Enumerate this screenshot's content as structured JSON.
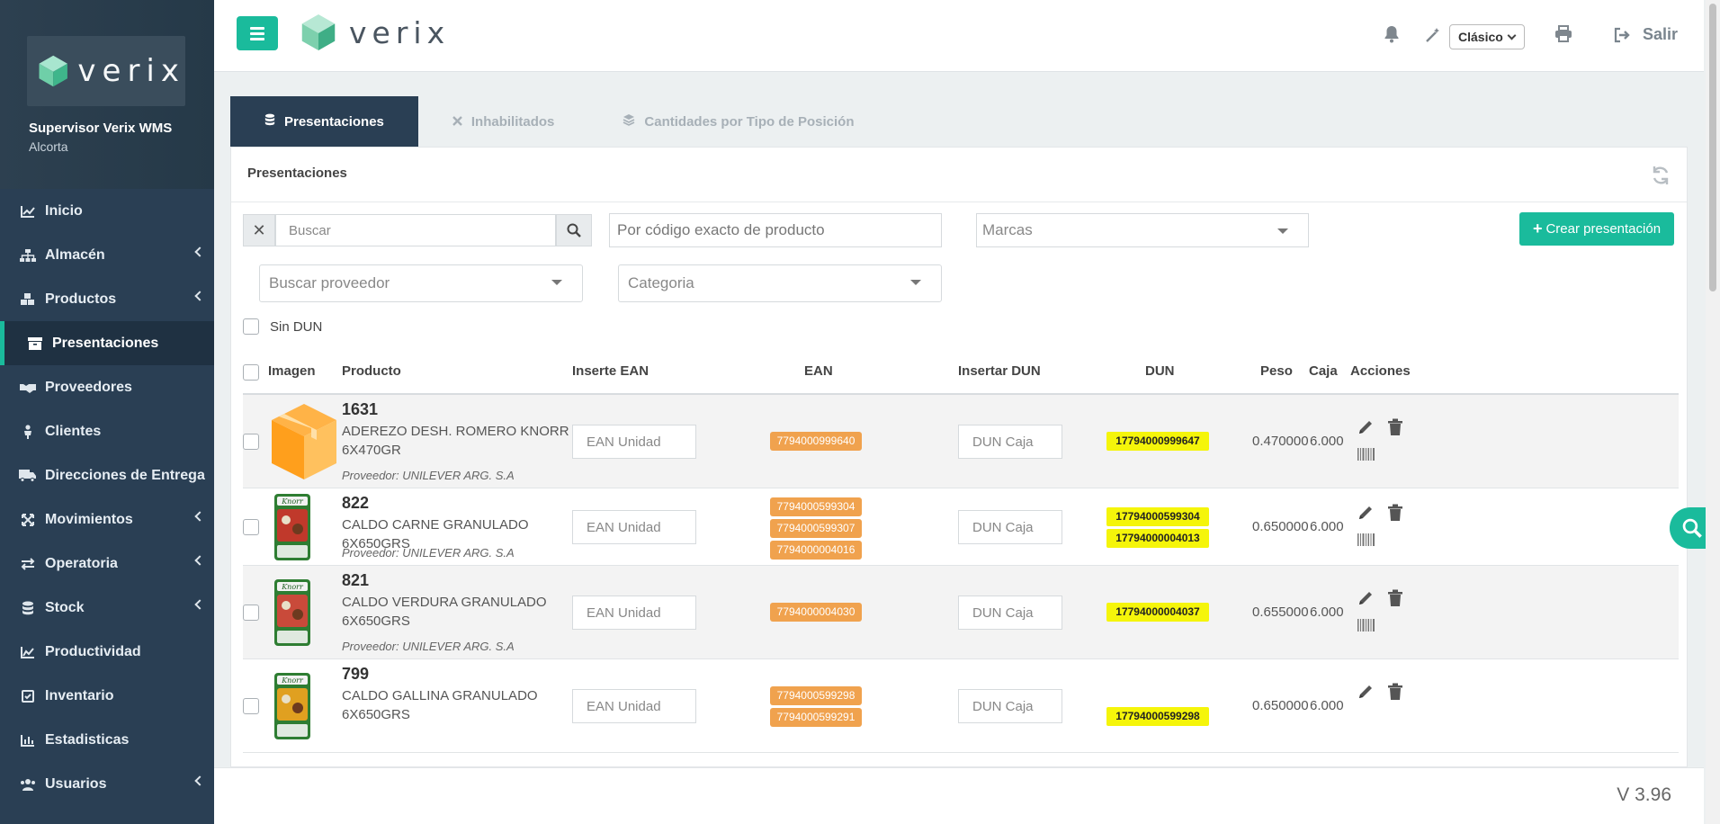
{
  "app": {
    "brand": "verix"
  },
  "sidebar": {
    "user_name": "Supervisor Verix WMS",
    "site": "Alcorta",
    "items": [
      {
        "label": "Inicio",
        "icon": "line-chart-icon",
        "has_submenu": false,
        "active": false
      },
      {
        "label": "Almacén",
        "icon": "sitemap-icon",
        "has_submenu": true,
        "active": false
      },
      {
        "label": "Productos",
        "icon": "cubes-icon",
        "has_submenu": true,
        "active": false
      },
      {
        "label": "Presentaciones",
        "icon": "archive-icon",
        "has_submenu": false,
        "active": true
      },
      {
        "label": "Proveedores",
        "icon": "handshake-icon",
        "has_submenu": false,
        "active": false
      },
      {
        "label": "Clientes",
        "icon": "user-icon",
        "has_submenu": false,
        "active": false
      },
      {
        "label": "Direcciones de Entrega",
        "icon": "truck-icon",
        "has_submenu": false,
        "active": false
      },
      {
        "label": "Movimientos",
        "icon": "arrows-icon",
        "has_submenu": true,
        "active": false
      },
      {
        "label": "Operatoria",
        "icon": "exchange-icon",
        "has_submenu": true,
        "active": false
      },
      {
        "label": "Stock",
        "icon": "database-icon",
        "has_submenu": true,
        "active": false
      },
      {
        "label": "Productividad",
        "icon": "area-chart-icon",
        "has_submenu": false,
        "active": false
      },
      {
        "label": "Inventario",
        "icon": "check-square-icon",
        "has_submenu": false,
        "active": false
      },
      {
        "label": "Estadisticas",
        "icon": "bar-chart-icon",
        "has_submenu": false,
        "active": false
      },
      {
        "label": "Usuarios",
        "icon": "users-icon",
        "has_submenu": true,
        "active": false
      }
    ]
  },
  "topbar": {
    "theme_selected": "Clásico",
    "logout_label": "Salir"
  },
  "tabs": [
    {
      "label": "Presentaciones",
      "icon": "database-icon",
      "active": true
    },
    {
      "label": "Inhabilitados",
      "icon": "close-icon",
      "active": false
    },
    {
      "label": "Cantidades por Tipo de Posición",
      "icon": "layers-icon",
      "active": false
    }
  ],
  "panel": {
    "title": "Presentaciones",
    "search_placeholder": "Buscar",
    "code_placeholder": "Por código exacto de producto",
    "brands_placeholder": "Marcas",
    "create_label": "Crear presentación",
    "supplier_placeholder": "Buscar proveedor",
    "category_placeholder": "Categoria",
    "no_dun_label": "Sin DUN"
  },
  "table": {
    "headers": {
      "image": "Imagen",
      "product": "Producto",
      "insert_ean": "Inserte EAN",
      "ean": "EAN",
      "insert_dun": "Insertar DUN",
      "dun": "DUN",
      "weight": "Peso",
      "box": "Caja",
      "actions": "Acciones"
    },
    "ean_placeholder": "EAN Unidad",
    "dun_placeholder": "DUN Caja",
    "rows": [
      {
        "code": "1631",
        "description": "ADEREZO DESH. ROMERO KNORR 6X470GR",
        "supplier": "Proveedor: UNILEVER ARG. S.A",
        "image": "box",
        "eans": [
          "7794000999640"
        ],
        "duns": [
          "17794000999647"
        ],
        "weight": "0.470000",
        "box": "6.000"
      },
      {
        "code": "822",
        "description": "CALDO CARNE GRANULADO 6X650GRS",
        "supplier": "Proveedor: UNILEVER ARG. S.A",
        "image": "knorr-red",
        "eans": [
          "7794000599304",
          "7794000599307",
          "7794000004016"
        ],
        "duns": [
          "17794000599304",
          "17794000004013"
        ],
        "weight": "0.650000",
        "box": "6.000"
      },
      {
        "code": "821",
        "description": "CALDO VERDURA GRANULADO 6X650GRS",
        "supplier": "Proveedor: UNILEVER ARG. S.A",
        "image": "knorr-green",
        "eans": [
          "7794000004030"
        ],
        "duns": [
          "17794000004037"
        ],
        "weight": "0.655000",
        "box": "6.000"
      },
      {
        "code": "799",
        "description": "CALDO GALLINA GRANULADO 6X650GRS",
        "supplier": "",
        "image": "knorr-yellow",
        "eans": [
          "7794000599298",
          "7794000599291"
        ],
        "duns": [
          "17794000599298"
        ],
        "weight": "0.650000",
        "box": "6.000"
      }
    ]
  },
  "footer": {
    "version": "V 3.96"
  }
}
